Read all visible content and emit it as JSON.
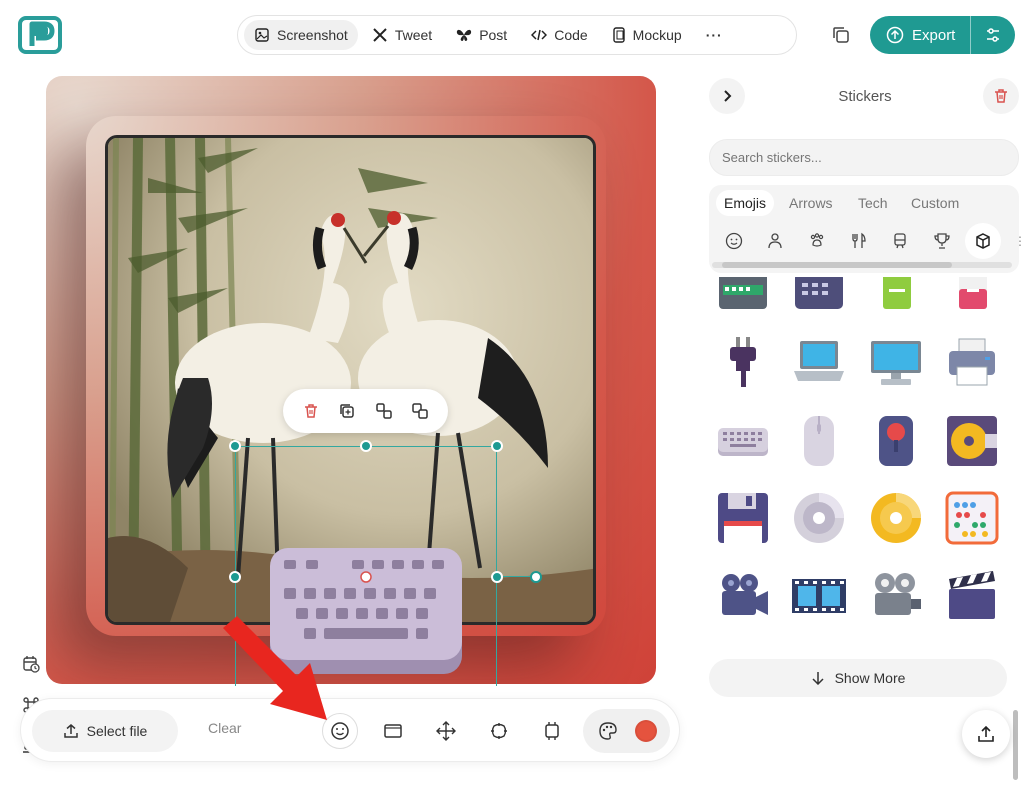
{
  "header": {
    "tabs": [
      {
        "label": "Screenshot",
        "icon": "image-icon"
      },
      {
        "label": "Tweet",
        "icon": "x-icon"
      },
      {
        "label": "Post",
        "icon": "butterfly-icon"
      },
      {
        "label": "Code",
        "icon": "code-icon"
      },
      {
        "label": "Mockup",
        "icon": "phone-icon"
      },
      {
        "label": "···",
        "icon": "more-icon"
      }
    ],
    "active_tab": "Screenshot",
    "export_label": "Export"
  },
  "canvas": {
    "background_colors": [
      "#e8d9cf",
      "#d4584b",
      "#cf4238"
    ],
    "image_subject": "two red-crowned cranes with bamboo"
  },
  "bottom_bar": {
    "select_file_label": "Select file",
    "clear_label": "Clear",
    "selected_color": "#e5533e"
  },
  "panel": {
    "title": "Stickers",
    "search_placeholder": "Search stickers...",
    "tabs": [
      "Emojis",
      "Arrows",
      "Tech",
      "Custom"
    ],
    "active_tab": "Emojis",
    "categories": [
      "smiley",
      "person",
      "animal",
      "food",
      "travel",
      "activity",
      "objects"
    ],
    "active_category": "objects",
    "show_more_label": "Show More"
  },
  "colors": {
    "accent": "#1f9a92",
    "selection": "#33a8a0",
    "arrow": "#e8261f"
  }
}
